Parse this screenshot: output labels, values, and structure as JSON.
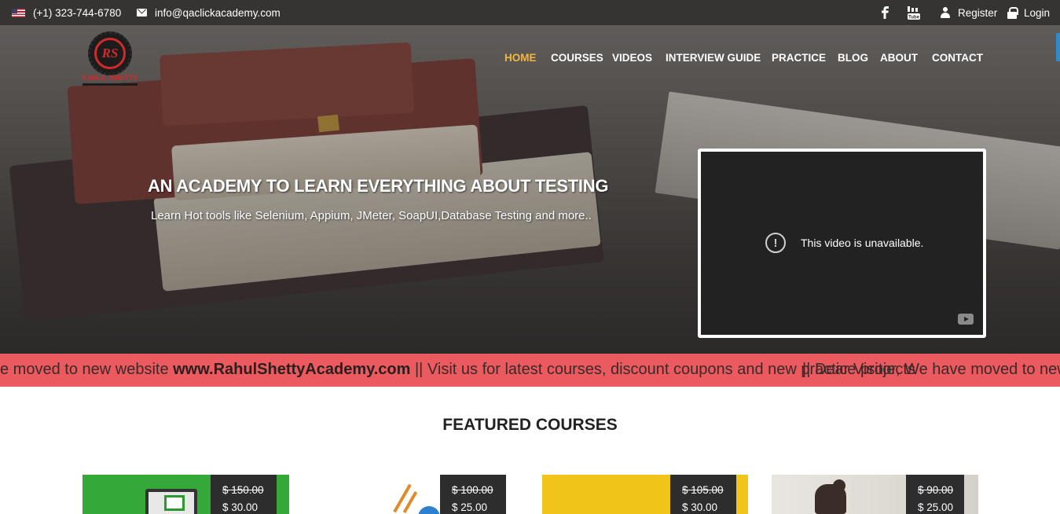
{
  "topbar": {
    "phone": "(+1) 323-744-6780",
    "email": "info@qaclickacademy.com",
    "register": "Register",
    "login": "Login",
    "icons": [
      "us-flag-icon",
      "envelope-icon",
      "facebook-icon",
      "youtube-icon",
      "user-icon",
      "lock-icon"
    ]
  },
  "logo": {
    "text": "RAHUL SHETTY"
  },
  "nav": {
    "items": [
      "HOME",
      "COURSES",
      "VIDEOS",
      "INTERVIEW GUIDE",
      "PRACTICE",
      "BLOG",
      "ABOUT",
      "CONTACT"
    ],
    "active": "HOME",
    "active_color": "#f2b73d"
  },
  "hero": {
    "headline": "AN ACADEMY TO LEARN EVERYTHING ABOUT TESTING",
    "subline": "Learn Hot tools like Selenium, Appium, JMeter, SoapUI,Database Testing and more.."
  },
  "video": {
    "message": "This video is unavailable."
  },
  "marquee": {
    "lead": "e moved to new website ",
    "site": "www.RahulShettyAcademy.com",
    "tail": " || Visit us for latest courses, discount coupons and new practice projects",
    "overlap": "|| Dear Visitor, We have moved to new",
    "background": "#ea5a5e"
  },
  "featured": {
    "title": "FEATURED COURSES",
    "courses": [
      {
        "old_price": "$ 150.00",
        "price": "$ 30.00"
      },
      {
        "old_price": "$ 100.00",
        "price": "$ 25.00"
      },
      {
        "old_price": "$ 105.00",
        "price": "$ 30.00"
      },
      {
        "old_price": "$ 90.00",
        "price": "$ 25.00"
      }
    ]
  }
}
